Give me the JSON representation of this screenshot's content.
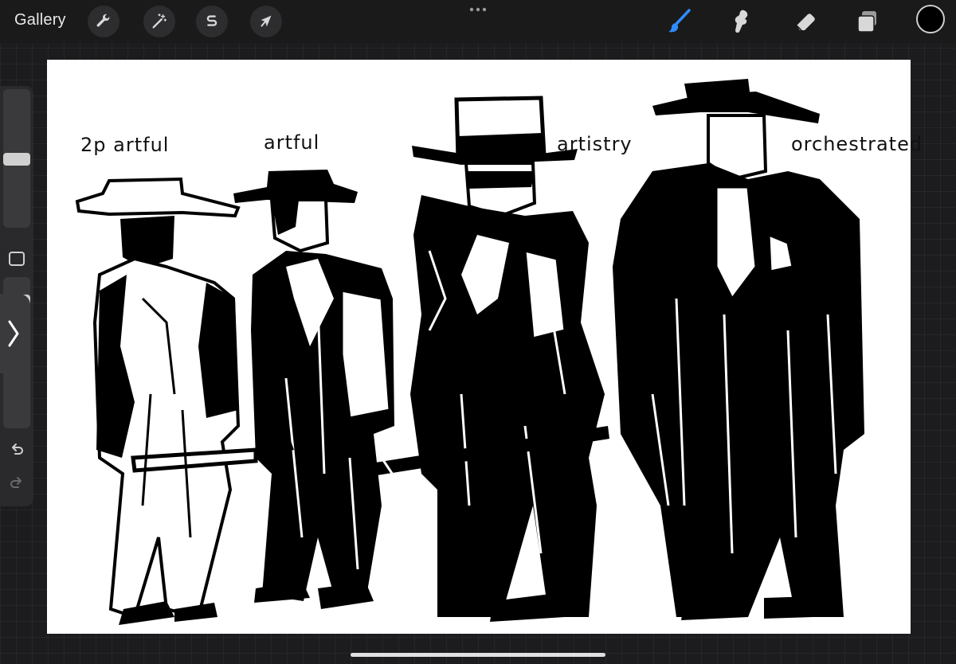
{
  "topbar": {
    "gallery_label": "Gallery",
    "left_tools": [
      {
        "name": "actions",
        "icon": "wrench-icon"
      },
      {
        "name": "adjustments",
        "icon": "magic-wand-icon"
      },
      {
        "name": "selection",
        "icon": "selection-s-icon"
      },
      {
        "name": "transform",
        "icon": "arrow-cursor-icon"
      }
    ],
    "right_tools": [
      {
        "name": "brush",
        "icon": "brush-icon",
        "active": true
      },
      {
        "name": "smudge",
        "icon": "smudge-icon",
        "active": false
      },
      {
        "name": "eraser",
        "icon": "eraser-icon",
        "active": false
      },
      {
        "name": "layers",
        "icon": "layers-icon",
        "active": false
      }
    ],
    "current_color": "#000000",
    "accent_color": "#2f8cff"
  },
  "sidebar": {
    "brush_size_control": "slider",
    "opacity_control": "slider",
    "modify_button": "square-icon",
    "toggle_icon": "chevron-right-icon",
    "undo_icon": "undo-icon",
    "redo_icon": "redo-icon"
  },
  "canvas": {
    "background": "#ffffff",
    "labels": [
      "2p artful",
      "artful",
      "artistry",
      "orchestrated"
    ],
    "figure_count": 4
  }
}
